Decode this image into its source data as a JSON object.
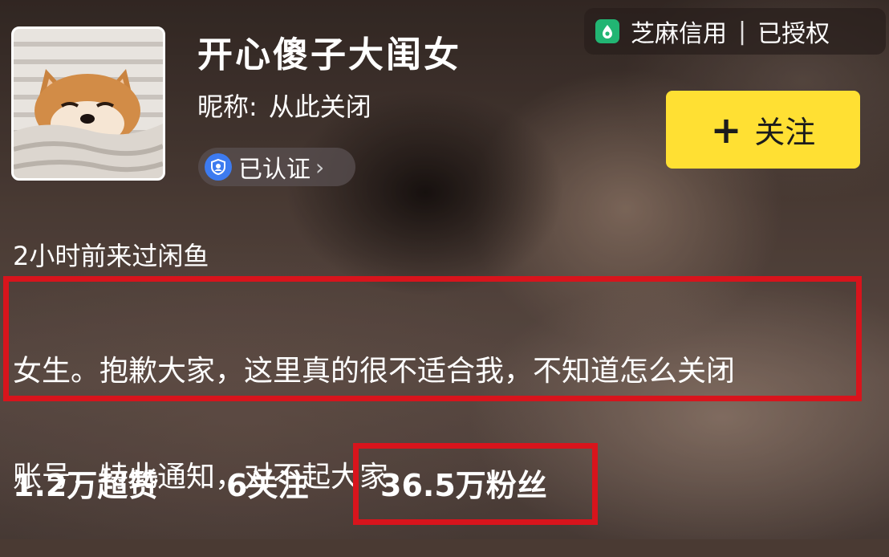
{
  "credit": {
    "icon": "sesame-credit-icon",
    "label": "芝麻信用",
    "separator": "|",
    "status": "已授权",
    "accent": "#22b573"
  },
  "profile": {
    "avatar_icon": "shiba-dog-avatar",
    "name": "开心傻子大闺女",
    "nickname_label": "昵称:",
    "nickname_value": "从此关闭",
    "verified_label": "已认证",
    "verified_icon": "verified-shield-icon",
    "chevron": "›"
  },
  "follow_button": {
    "icon": "+",
    "label": "关注",
    "color": "#ffe033"
  },
  "last_seen": "2小时前来过闲鱼",
  "bio": {
    "line1": "女生。抱歉大家，这里真的很不适合我，不知道怎么关闭",
    "line2": "账号，特此通知，对不起大家",
    "highlight_color": "#d8141c"
  },
  "stats": {
    "likes": "1.2万超赞",
    "following": "6关注",
    "fans": "36.5万粉丝"
  }
}
